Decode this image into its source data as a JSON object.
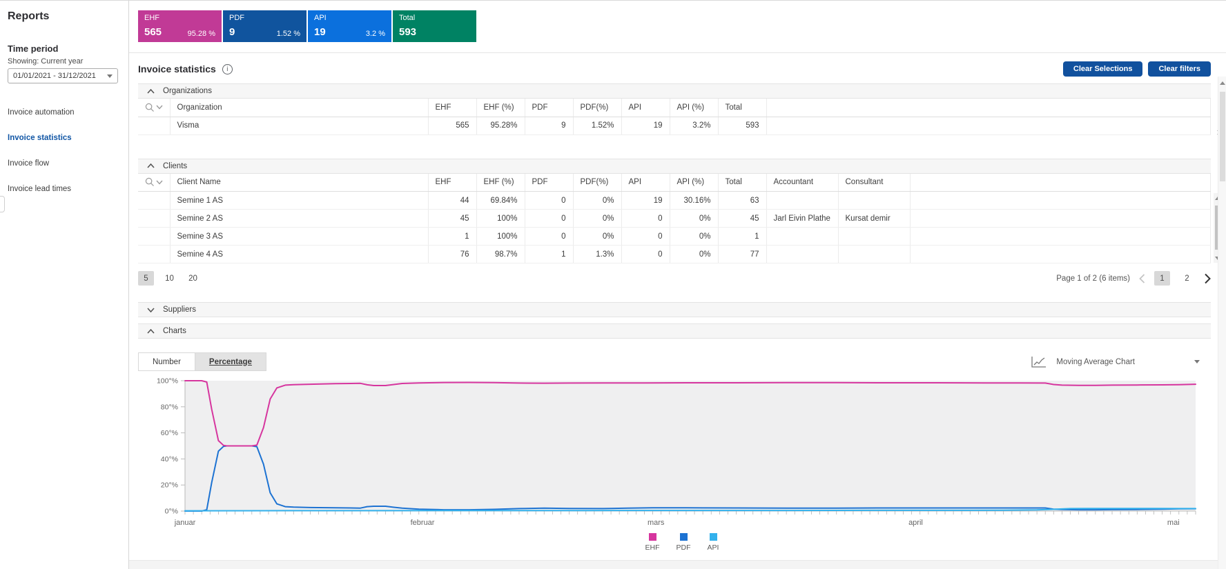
{
  "sidebar": {
    "title": "Reports",
    "time_period": {
      "heading": "Time period",
      "showing": "Showing: Current year",
      "range": "01/01/2021 - 31/12/2021"
    },
    "nav": [
      {
        "label": "Invoice automation",
        "active": false
      },
      {
        "label": "Invoice statistics",
        "active": true
      },
      {
        "label": "Invoice flow",
        "active": false
      },
      {
        "label": "Invoice lead times",
        "active": false
      }
    ]
  },
  "summary_cards": [
    {
      "label": "EHF",
      "value": "565",
      "percent": "95.28 %",
      "color": "#c13a96"
    },
    {
      "label": "PDF",
      "value": "9",
      "percent": "1.52 %",
      "color": "#10549e"
    },
    {
      "label": "API",
      "value": "19",
      "percent": "3.2 %",
      "color": "#0b70dd"
    },
    {
      "label": "Total",
      "value": "593",
      "percent": "",
      "color": "#008263"
    }
  ],
  "page": {
    "title": "Invoice statistics",
    "buttons": {
      "clear_selections": "Clear Selections",
      "clear_filters": "Clear filters"
    }
  },
  "organizations": {
    "section_label": "Organizations",
    "columns": [
      "Organization",
      "EHF",
      "EHF (%)",
      "PDF",
      "PDF(%)",
      "API",
      "API (%)",
      "Total"
    ],
    "rows": [
      [
        "Visma",
        "565",
        "95.28%",
        "9",
        "1.52%",
        "19",
        "3.2%",
        "593"
      ]
    ]
  },
  "clients": {
    "section_label": "Clients",
    "columns": [
      "Client Name",
      "EHF",
      "EHF (%)",
      "PDF",
      "PDF(%)",
      "API",
      "API (%)",
      "Total",
      "Accountant",
      "Consultant"
    ],
    "rows": [
      [
        "Semine 1 AS",
        "44",
        "69.84%",
        "0",
        "0%",
        "19",
        "30.16%",
        "63",
        "",
        ""
      ],
      [
        "Semine 2 AS",
        "45",
        "100%",
        "0",
        "0%",
        "0",
        "0%",
        "45",
        "Jarl Eivin Plathe",
        "Kursat demir"
      ],
      [
        "Semine 3 AS",
        "1",
        "100%",
        "0",
        "0%",
        "0",
        "0%",
        "1",
        "",
        ""
      ],
      [
        "Semine 4 AS",
        "76",
        "98.7%",
        "1",
        "1.3%",
        "0",
        "0%",
        "77",
        "",
        ""
      ]
    ],
    "pagination": {
      "sizes": [
        "5",
        "10",
        "20"
      ],
      "active_size": "5",
      "info": "Page 1 of 2 (6 items)",
      "pages": [
        "1",
        "2"
      ],
      "active_page": "1"
    }
  },
  "suppliers": {
    "section_label": "Suppliers"
  },
  "charts_section": {
    "section_label": "Charts",
    "toggle": {
      "number": "Number",
      "percentage": "Percentage",
      "selected": "Percentage"
    },
    "selector_label": "Moving Average Chart"
  },
  "icons": {
    "info": "info-circle",
    "search": "magnifier",
    "filter_dropdown": "chevron-down",
    "section_collapse": "chevron-up",
    "section_expand": "chevron-down",
    "date_dropdown": "caret-down",
    "prev_page": "chevron-left",
    "next_page": "chevron-right",
    "chart_selector": "moving-average-line",
    "selector_caret": "caret-down"
  },
  "colors": {
    "accent_blue": "#11519e",
    "active_nav": "#1156a5",
    "selected_gray": "#d8d8d8",
    "plot_background": "#efeff0"
  },
  "chart_data": {
    "type": "line",
    "title": "",
    "y_axis": {
      "min": 0,
      "max": 100,
      "ticks": [
        {
          "label": "0°%",
          "value": 0
        },
        {
          "label": "20°%",
          "value": 20
        },
        {
          "label": "40°%",
          "value": 40
        },
        {
          "label": "60°%",
          "value": 60
        },
        {
          "label": "80°%",
          "value": 80
        },
        {
          "label": "100°%",
          "value": 100
        }
      ]
    },
    "x_axis": {
      "days_total": 121,
      "months": [
        {
          "label": "januar",
          "pos": 0.0
        },
        {
          "label": "februar",
          "pos": 0.235
        },
        {
          "label": "mars",
          "pos": 0.466
        },
        {
          "label": "april",
          "pos": 0.723
        },
        {
          "label": "mai",
          "pos": 0.978
        }
      ]
    },
    "legend_position": "bottom-center",
    "series": [
      {
        "name": "EHF",
        "color": "#d6359e",
        "points": [
          [
            0,
            100
          ],
          [
            1,
            100
          ],
          [
            2,
            100
          ],
          [
            2.6,
            99
          ],
          [
            3.2,
            78
          ],
          [
            4,
            54
          ],
          [
            4.6,
            50.4
          ],
          [
            5,
            50
          ],
          [
            6,
            50
          ],
          [
            7,
            50
          ],
          [
            8,
            50
          ],
          [
            8.6,
            50.6
          ],
          [
            9.4,
            64
          ],
          [
            10.2,
            86
          ],
          [
            11,
            94.5
          ],
          [
            12,
            96.6
          ],
          [
            13,
            97
          ],
          [
            15,
            97.3
          ],
          [
            18,
            97.8
          ],
          [
            21,
            98
          ],
          [
            21.8,
            96.9
          ],
          [
            22.6,
            96.3
          ],
          [
            24,
            96.3
          ],
          [
            25,
            97.1
          ],
          [
            26,
            97.9
          ],
          [
            28,
            98.3
          ],
          [
            31,
            98.6
          ],
          [
            34,
            98.7
          ],
          [
            37,
            98.5
          ],
          [
            40,
            98.2
          ],
          [
            43,
            98.1
          ],
          [
            46,
            98.2
          ],
          [
            50,
            98.3
          ],
          [
            55,
            98.3
          ],
          [
            60,
            98.4
          ],
          [
            66,
            98.4
          ],
          [
            72,
            98.5
          ],
          [
            78,
            98.5
          ],
          [
            84,
            98.4
          ],
          [
            90,
            98.4
          ],
          [
            96,
            98.3
          ],
          [
            100,
            98.3
          ],
          [
            103,
            98.2
          ],
          [
            104,
            97.1
          ],
          [
            105,
            96.6
          ],
          [
            107,
            96.4
          ],
          [
            109,
            96.4
          ],
          [
            111,
            96.6
          ],
          [
            114,
            96.7
          ],
          [
            117,
            96.8
          ],
          [
            119,
            97
          ],
          [
            121,
            97.3
          ]
        ]
      },
      {
        "name": "PDF",
        "color": "#1c72d2",
        "points": [
          [
            0,
            0
          ],
          [
            1,
            0
          ],
          [
            2,
            0
          ],
          [
            2.6,
            1
          ],
          [
            3.2,
            22
          ],
          [
            4,
            46
          ],
          [
            4.6,
            49.6
          ],
          [
            5,
            50
          ],
          [
            6,
            50
          ],
          [
            7,
            50
          ],
          [
            8,
            50
          ],
          [
            8.6,
            49.4
          ],
          [
            9.4,
            36
          ],
          [
            10.2,
            14
          ],
          [
            11,
            5.5
          ],
          [
            12,
            3.4
          ],
          [
            13,
            3
          ],
          [
            15,
            2.7
          ],
          [
            18,
            2.5
          ],
          [
            21,
            2.3
          ],
          [
            21.8,
            3.4
          ],
          [
            22.6,
            3.7
          ],
          [
            24,
            3.7
          ],
          [
            25,
            2.9
          ],
          [
            26,
            2.2
          ],
          [
            28,
            1.5
          ],
          [
            31,
            1
          ],
          [
            34,
            1
          ],
          [
            37,
            1.3
          ],
          [
            40,
            1.9
          ],
          [
            43,
            2.2
          ],
          [
            46,
            2
          ],
          [
            50,
            1.9
          ],
          [
            53,
            2.3
          ],
          [
            56,
            2.5
          ],
          [
            60,
            2.5
          ],
          [
            66,
            2.4
          ],
          [
            72,
            2.3
          ],
          [
            78,
            2.3
          ],
          [
            84,
            2.4
          ],
          [
            90,
            2.4
          ],
          [
            96,
            2.4
          ],
          [
            100,
            2.4
          ],
          [
            103,
            2.4
          ],
          [
            104,
            1.5
          ],
          [
            105,
            1.2
          ],
          [
            107,
            1
          ],
          [
            109,
            1
          ],
          [
            111,
            1.1
          ],
          [
            114,
            1.2
          ],
          [
            117,
            1.5
          ],
          [
            119,
            1.7
          ],
          [
            121,
            1.8
          ]
        ]
      },
      {
        "name": "API",
        "color": "#33b1ec",
        "points": [
          [
            0,
            0.2
          ],
          [
            12,
            0.3
          ],
          [
            24,
            0.3
          ],
          [
            36,
            0.4
          ],
          [
            48,
            0.4
          ],
          [
            60,
            0.5
          ],
          [
            72,
            0.5
          ],
          [
            84,
            0.6
          ],
          [
            92,
            0.6
          ],
          [
            98,
            0.7
          ],
          [
            102,
            0.9
          ],
          [
            104,
            1.4
          ],
          [
            106,
            1.9
          ],
          [
            108,
            2
          ],
          [
            112,
            2
          ],
          [
            116,
            2
          ],
          [
            119,
            1.9
          ],
          [
            121,
            1.9
          ]
        ]
      }
    ]
  }
}
